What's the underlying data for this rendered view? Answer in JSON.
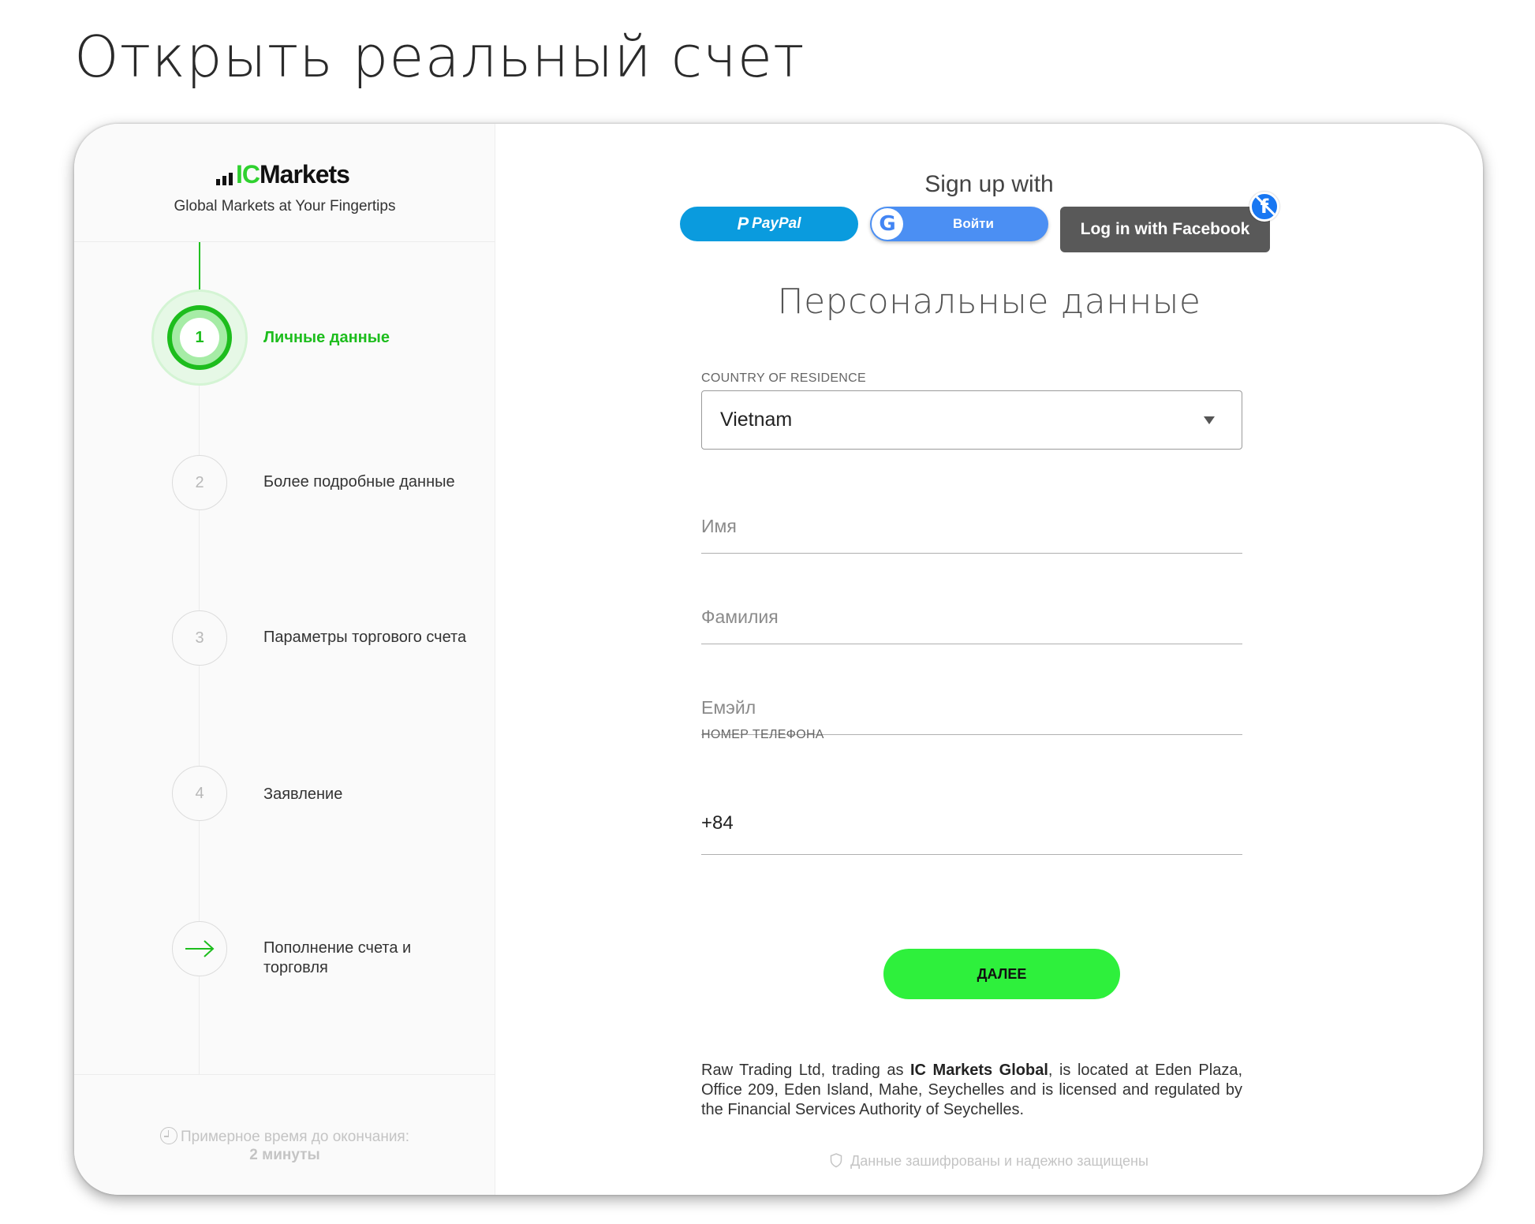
{
  "page": {
    "title": "Открыть реальный счет"
  },
  "sidebar": {
    "brand": {
      "logo_ic": "IC",
      "logo_markets": "Markets",
      "tagline": "Global Markets at Your Fingertips"
    },
    "steps": [
      {
        "number": "1",
        "label": "Личные данные",
        "active": true
      },
      {
        "number": "2",
        "label": "Более подробные данные"
      },
      {
        "number": "3",
        "label": "Параметры торгового счета"
      },
      {
        "number": "4",
        "label": "Заявление"
      },
      {
        "number": "",
        "icon": "arrow-right-icon",
        "label": "Пополнение счета и торговля"
      }
    ],
    "eta": {
      "label": "Примерное время до окончания:",
      "value": "2 минуты"
    }
  },
  "social": {
    "title": "Sign up with",
    "paypal_label": "PayPal",
    "google_label": "Войти",
    "facebook_label": "Log in with Facebook"
  },
  "form": {
    "section_title": "Персональные данные",
    "country_label": "COUNTRY OF RESIDENCE",
    "country_value": "Vietnam",
    "first_name_placeholder": "Имя",
    "last_name_placeholder": "Фамилия",
    "email_placeholder": "Емэйл",
    "phone_label": "НОМЕР ТЕЛЕФОНА",
    "phone_value": "+84",
    "next_button": "ДАЛЕЕ"
  },
  "legal": {
    "prefix": "Raw Trading Ltd, trading as ",
    "company": "IC Markets Global",
    "suffix": ", is located at Eden Plaza, Office 209, Eden Island, Mahe, Seychelles and is licensed and regulated by the Financial Services Authority of Seychelles."
  },
  "security_note": "Данные зашифрованы и надежно защищены",
  "colors": {
    "accent": "#1dbd1d",
    "button": "#2ef03c",
    "paypal": "#0a9bde",
    "google": "#4b8ff3",
    "facebook": "#595959"
  }
}
